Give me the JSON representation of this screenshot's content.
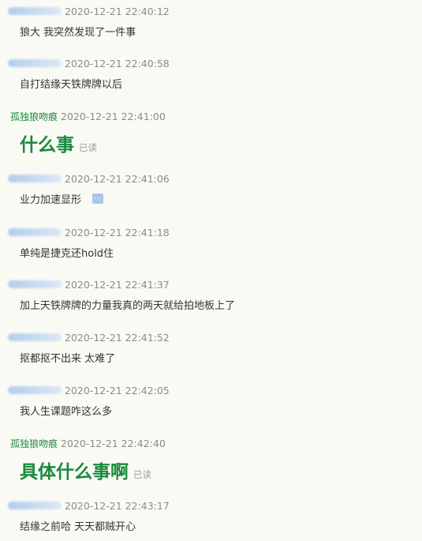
{
  "messages": [
    {
      "name": "",
      "time": "2020-12-21 22:40:12",
      "text": "狼大 我突然发现了一件事"
    },
    {
      "name": "",
      "time": "2020-12-21 22:40:58",
      "text": "自打结缘天铁牌牌以后"
    },
    {
      "name": "孤独狼吻痕",
      "time": "2020-12-21 22:41:00",
      "text": "什么事",
      "status": "已读"
    },
    {
      "name": "",
      "time": "2020-12-21 22:41:06",
      "text": "业力加速显形",
      "icon": "more-icon"
    },
    {
      "name": "",
      "time": "2020-12-21 22:41:18",
      "text": "单纯是捷克还hold住"
    },
    {
      "name": "",
      "time": "2020-12-21 22:41:37",
      "text": "加上天铁牌牌的力量我真的两天就给拍地板上了"
    },
    {
      "name": "",
      "time": "2020-12-21 22:41:52",
      "text": "抠都抠不出来 太难了"
    },
    {
      "name": "",
      "time": "2020-12-21 22:42:05",
      "text": "我人生课题咋这么多"
    },
    {
      "name": "孤独狼吻痕",
      "time": "2020-12-21 22:42:40",
      "text": "具体什么事啊",
      "status": "已读"
    },
    {
      "name": "",
      "time": "2020-12-21 22:43:17",
      "text": "结缘之前哈 天天都贼开心"
    }
  ],
  "colors": {
    "accent": "#1a8a3c",
    "timestamp": "#8a8a8a",
    "background": "#fafaf5"
  }
}
